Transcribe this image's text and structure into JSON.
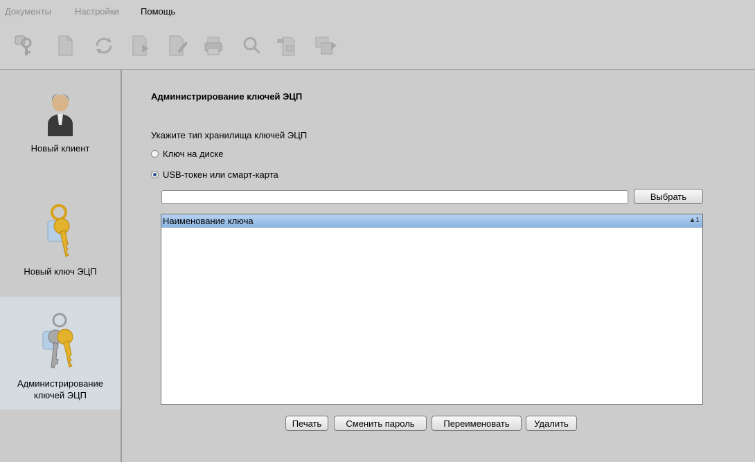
{
  "menu": {
    "documents": "Документы",
    "settings": "Настройки",
    "help": "Помощь"
  },
  "sidebar": {
    "items": [
      {
        "label": "Новый клиент",
        "icon": "user-icon"
      },
      {
        "label": "Новый ключ ЭЦП",
        "icon": "key-icon"
      },
      {
        "label": "Администрирование\nключей ЭЦП",
        "icon": "keys-admin-icon",
        "active": true
      }
    ]
  },
  "main": {
    "title": "Администрирование ключей ЭЦП",
    "prompt": "Укажите тип хранилища ключей ЭЦП",
    "options": [
      {
        "label": "Ключ на диске",
        "checked": false
      },
      {
        "label": "USB-токен или смарт-карта",
        "checked": true
      }
    ],
    "path_value": "",
    "choose_button": "Выбрать",
    "table": {
      "column": "Наименование ключа",
      "sort_indicator": "▲1",
      "rows": []
    },
    "buttons": {
      "print": "Печать",
      "change_password": "Сменить пароль",
      "rename": "Переименовать",
      "delete": "Удалить"
    }
  },
  "colors": {
    "active_sidebar": "#d4dbe1",
    "table_header": "#a9c8ec"
  }
}
